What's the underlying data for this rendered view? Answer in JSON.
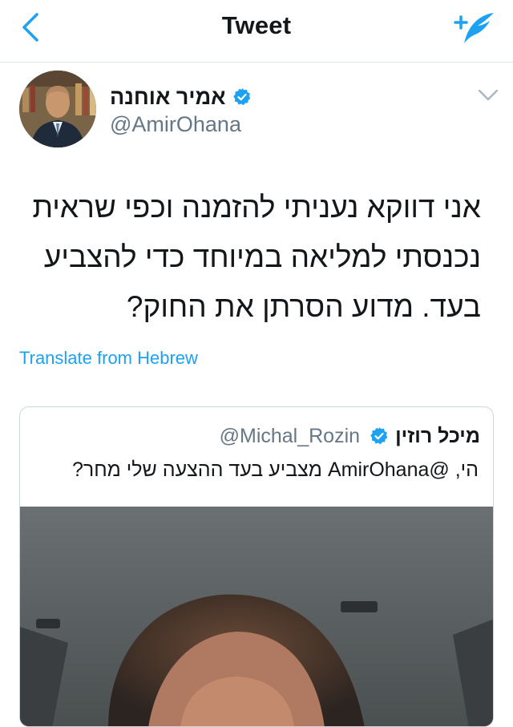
{
  "nav": {
    "title": "Tweet",
    "back_icon": "chevron-left-icon",
    "compose_icon": "compose-quill-icon",
    "accent": "#1da1f2"
  },
  "author": {
    "name": "אמיר אוחנה",
    "handle": "@AmirOhana",
    "verified": true
  },
  "tweet": {
    "text": "אני דווקא נעניתי להזמנה וכפי שראית נכנסתי למליאה במיוחד כדי להצביע בעד. מדוע  הסרתן את החוק?",
    "translate_label": "Translate from Hebrew"
  },
  "quoted": {
    "name": "מיכל רוזין",
    "handle": "@Michal_Rozin",
    "verified": true,
    "text": "הי, @AmirOhana מצביע בעד ההצעה שלי מחר?"
  },
  "colors": {
    "text": "#14171a",
    "secondary": "#657786",
    "link": "#1da1f2",
    "border": "#ccd6dd"
  }
}
